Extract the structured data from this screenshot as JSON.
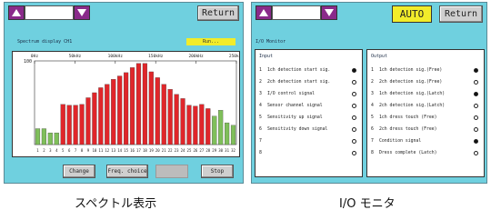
{
  "spectrum": {
    "return_label": "Return",
    "title": "Spectrum display CH1",
    "run_label": "Run...",
    "y_tick": "100",
    "freq_labels": [
      "0Hz",
      "50kHz",
      "100kHz",
      "150kHz",
      "200kHz",
      "250kHz"
    ],
    "buttons": {
      "change": "Change",
      "freq_choice": "Freq. choice",
      "disabled": "",
      "stop": "Stop"
    },
    "caption": "スペクトル表示"
  },
  "monitor": {
    "auto_label": "AUTO",
    "return_label": "Return",
    "title": "I/O Monitor",
    "input_header": "Input",
    "output_header": "Output",
    "inputs": [
      {
        "num": "1",
        "label": "1ch detection start sig.",
        "on": true
      },
      {
        "num": "2",
        "label": "2ch detection start sig.",
        "on": false
      },
      {
        "num": "3",
        "label": "I/O control signal",
        "on": false
      },
      {
        "num": "4",
        "label": "Sensor channel signal",
        "on": false
      },
      {
        "num": "5",
        "label": "Sensitivity up signal",
        "on": false
      },
      {
        "num": "6",
        "label": "Sensitivity down signal",
        "on": false
      },
      {
        "num": "7",
        "label": "",
        "on": false
      },
      {
        "num": "8",
        "label": "",
        "on": false
      }
    ],
    "outputs": [
      {
        "num": "1",
        "label": "1ch detection sig.(Free)",
        "on": true
      },
      {
        "num": "2",
        "label": "2ch detection sig.(Free)",
        "on": false
      },
      {
        "num": "3",
        "label": "1ch detection sig.(Latch)",
        "on": true
      },
      {
        "num": "4",
        "label": "2ch detection sig.(Latch)",
        "on": false
      },
      {
        "num": "5",
        "label": "1ch dress touch (Free)",
        "on": false
      },
      {
        "num": "6",
        "label": "2ch dress touch (Free)",
        "on": false
      },
      {
        "num": "7",
        "label": "Condition signal",
        "on": true
      },
      {
        "num": "8",
        "label": "Dress complete (Latch)",
        "on": false
      }
    ],
    "caption": "I/O モニタ"
  },
  "colors": {
    "panel": "#6fd0df",
    "red": "#e0262a",
    "green": "#7fbf5a",
    "accent": "#8a2a8a",
    "yellow": "#f2ec2a"
  },
  "chart_data": {
    "type": "bar",
    "categories": [
      "1",
      "2",
      "3",
      "4",
      "5",
      "6",
      "7",
      "8",
      "9",
      "10",
      "11",
      "12",
      "13",
      "14",
      "15",
      "16",
      "17",
      "18",
      "19",
      "20",
      "21",
      "22",
      "23",
      "24",
      "25",
      "26",
      "27",
      "28",
      "29",
      "30",
      "31",
      "32"
    ],
    "values": [
      19,
      19,
      14,
      14,
      48,
      47,
      47,
      48,
      56,
      62,
      68,
      72,
      78,
      82,
      86,
      92,
      97,
      97,
      87,
      80,
      72,
      66,
      60,
      55,
      47,
      46,
      48,
      43,
      34,
      41,
      26,
      23
    ],
    "highlight": [
      5,
      6,
      7,
      8,
      9,
      10,
      11,
      12,
      13,
      14,
      15,
      16,
      17,
      18,
      19,
      20,
      21,
      22,
      23,
      24,
      25,
      26,
      27,
      28
    ],
    "ylim": [
      0,
      100
    ],
    "y_tick": "100",
    "x_top_labels": [
      "0Hz",
      "50kHz",
      "100kHz",
      "150kHz",
      "200kHz",
      "250kHz"
    ]
  }
}
